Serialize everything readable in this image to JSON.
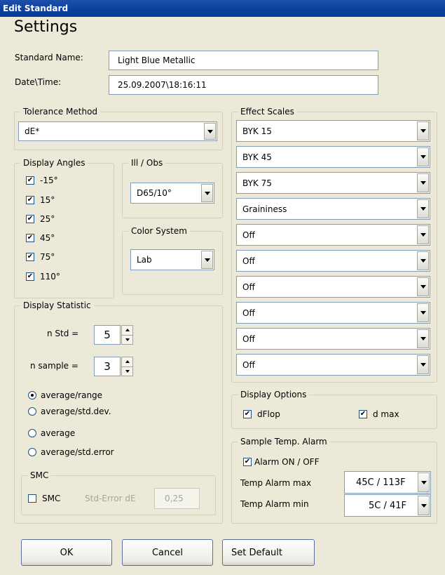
{
  "window": {
    "title": "Edit Standard"
  },
  "heading": "Settings",
  "standard_name": {
    "label": "Standard Name:",
    "value": "Light Blue Metallic"
  },
  "date_time": {
    "label": "Date\\Time:",
    "value": "25.09.2007\\18:16:11"
  },
  "tolerance": {
    "legend": "Tolerance Method",
    "value": "dE*"
  },
  "display_angles": {
    "legend": "Display Angles",
    "items": [
      {
        "label": "-15°",
        "checked": true
      },
      {
        "label": "15°",
        "checked": true
      },
      {
        "label": "25°",
        "checked": true
      },
      {
        "label": "45°",
        "checked": true
      },
      {
        "label": "75°",
        "checked": true
      },
      {
        "label": "110°",
        "checked": true
      }
    ]
  },
  "ill_obs": {
    "legend": "Ill / Obs",
    "value": "D65/10°"
  },
  "color_system": {
    "legend": "Color System",
    "value": "Lab"
  },
  "display_statistic": {
    "legend": "Display Statistic",
    "n_std": {
      "label": "n Std =",
      "value": "5"
    },
    "n_sample": {
      "label": "n sample =",
      "value": "3"
    },
    "options": [
      {
        "label": "average/range",
        "selected": true
      },
      {
        "label": "average/std.dev.",
        "selected": false
      },
      {
        "label": "average",
        "selected": false
      },
      {
        "label": "average/std.error",
        "selected": false
      }
    ],
    "smc": {
      "legend": "SMC",
      "checkbox_label": "SMC",
      "checked": false,
      "std_error_label": "Std-Error dE",
      "std_error_value": "0,25"
    }
  },
  "effect_scales": {
    "legend": "Effect Scales",
    "items": [
      "BYK 15",
      "BYK 45",
      "BYK 75",
      "Graininess",
      "Off",
      "Off",
      "Off",
      "Off",
      "Off",
      "Off"
    ]
  },
  "display_options": {
    "legend": "Display Options",
    "dflop": {
      "label": "dFlop",
      "checked": true
    },
    "dmax": {
      "label": "d max",
      "checked": true
    }
  },
  "temp_alarm": {
    "legend": "Sample Temp. Alarm",
    "alarm_toggle": {
      "label": "Alarm ON / OFF",
      "checked": true
    },
    "max": {
      "label": "Temp Alarm max",
      "value": "45C / 113F"
    },
    "min": {
      "label": "Temp Alarm min",
      "value": "5C / 41F"
    }
  },
  "buttons": {
    "ok": "OK",
    "cancel": "Cancel",
    "set_default": "Set Default"
  },
  "icons": {
    "dropdown": "chevron-down-icon",
    "check": "checkmark-icon",
    "spin_up": "spin-up-icon",
    "spin_down": "spin-down-icon"
  },
  "colors": {
    "titlebar": "#0a3f9e",
    "dialog_bg": "#ece9d8",
    "field_border": "#7f9db9"
  }
}
